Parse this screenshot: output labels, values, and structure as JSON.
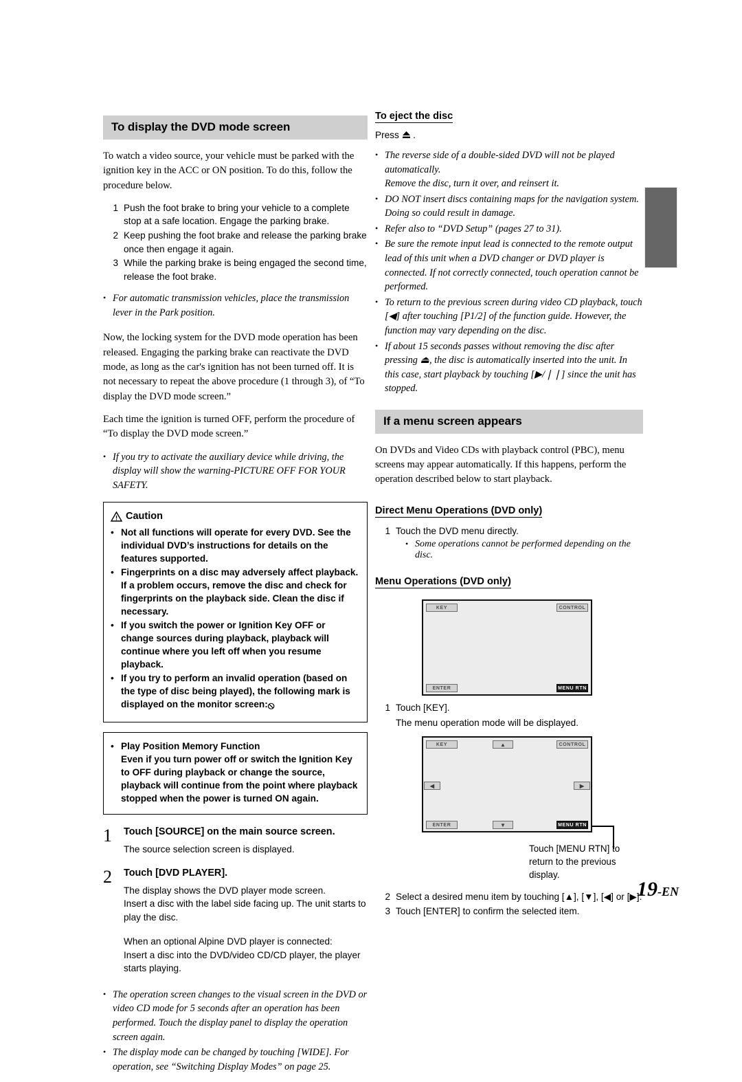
{
  "page": {
    "number": "19",
    "number_suffix": "-EN"
  },
  "left_column": {
    "section_title": "To display the DVD mode screen",
    "intro": "To watch a video source, your vehicle must be parked with the ignition key in the ACC or ON position. To do this, follow the procedure below.",
    "procedure": [
      {
        "num": "1",
        "text": "Push the foot brake to bring your vehicle to a complete stop at a safe location. Engage the parking brake."
      },
      {
        "num": "2",
        "text": "Keep pushing the foot brake and release the parking brake once then engage it again."
      },
      {
        "num": "3",
        "text": "While the parking brake is being engaged the second time, release the foot brake."
      }
    ],
    "note_after_procedure": "For automatic transmission vehicles, place the transmission lever in the Park position.",
    "paragraph_locking": "Now, the locking system for the DVD mode operation has been released. Engaging the parking brake can reactivate the DVD mode, as long as the car's ignition has not been turned off.  It is not necessary to repeat the above procedure (1 through 3),  of “To display the DVD mode screen.”",
    "paragraph_ignition": "Each time the ignition is turned OFF, perform the procedure of “To display the DVD mode screen.”",
    "note_aux": "If you try to activate the auxiliary device while driving, the display will show the warning-PICTURE OFF FOR YOUR SAFETY.",
    "caution": {
      "title": "Caution",
      "items": [
        "Not all functions will operate for every DVD. See the individual DVD’s instructions for details on the features supported.",
        "Fingerprints on a disc may adversely affect playback. If a problem occurs, remove the disc and check for fingerprints on the playback side. Clean the disc if necessary.",
        "If you switch the power or Ignition Key OFF or change sources during playback, playback will continue where you left off when you resume playback.",
        "If you try to perform an invalid operation (based on the type of disc being played), the following mark is displayed on the monitor screen:"
      ],
      "invalid_mark": "⦸"
    },
    "memory_box": {
      "title": "Play Position Memory Function",
      "text": "Even if you turn power off or switch the Ignition Key to OFF during playback or change the source, playback will continue from the point where playback stopped when the power is turned ON again."
    },
    "steps": [
      {
        "num": "1",
        "title": "Touch [SOURCE] on the main source screen.",
        "desc": "The source selection screen is displayed."
      },
      {
        "num": "2",
        "title": "Touch [DVD PLAYER].",
        "desc": "The display shows the DVD player mode screen.\nInsert a disc with the label side facing up. The unit starts to play the disc.",
        "desc2": "When an optional Alpine DVD player is connected:\nInsert a disc into the DVD/video CD/CD player, the player starts playing."
      }
    ],
    "end_notes": [
      "The operation screen changes to the visual screen in the DVD or video CD mode for 5 seconds after an operation has been performed. Touch the display panel to display the operation screen again.",
      "The display mode can be changed by touching [WIDE]. For operation, see “Switching Display Modes” on page 25."
    ]
  },
  "right_column": {
    "eject": {
      "heading": "To eject the disc",
      "press_label": "Press",
      "press_glyph": "⏏",
      "press_period": ".",
      "notes": [
        "The reverse side of a double-sided DVD will not be played automatically.\nRemove the disc, turn it over, and reinsert it.",
        "DO NOT insert discs containing maps for the navigation system. Doing so could result in damage.",
        "Refer also to “DVD Setup” (pages 27 to 31).",
        "Be sure the remote input lead is connected to the remote output lead of this unit when a DVD changer or DVD player is connected. If not correctly connected, touch operation cannot be performed.",
        "To return to the previous screen during video CD playback, touch [◀] after touching [P1/2] of the function guide. However, the function may vary depending on the disc.",
        "If about 15 seconds passes without removing the disc after pressing ⏏, the disc is automatically inserted into the unit. In this case, start playback by touching [▶/❘❘] since the unit has stopped."
      ]
    },
    "menu_section": {
      "section_title": "If a menu screen appears",
      "intro": "On DVDs and Video CDs with playback control (PBC), menu screens may appear automatically.  If this happens, perform the operation described below to start playback.",
      "direct": {
        "heading": "Direct Menu Operations (DVD only)",
        "step_num": "1",
        "step_text": "Touch the DVD menu directly.",
        "sub_note": "Some operations cannot be performed depending on the disc."
      },
      "menu_ops": {
        "heading": "Menu Operations (DVD only)",
        "screen1": {
          "key": "KEY",
          "control": "CONTROL",
          "enter": "ENTER",
          "menu_rtn": "MENU RTN"
        },
        "step1_num": "1",
        "step1_text": "Touch [KEY].",
        "step1_desc": "The menu operation mode will be displayed.",
        "screen2": {
          "key": "KEY",
          "control": "CONTROL",
          "enter": "ENTER",
          "menu_rtn": "MENU RTN",
          "up": "▲",
          "down": "▼",
          "left": "◀",
          "right": "▶"
        },
        "callout": "Touch [MENU RTN] to return to the previous display.",
        "step2_num": "2",
        "step2_text": "Select a desired menu item by touching [▲], [▼], [◀] or [▶].",
        "step3_num": "3",
        "step3_text": "Touch [ENTER] to confirm the selected item."
      }
    }
  }
}
